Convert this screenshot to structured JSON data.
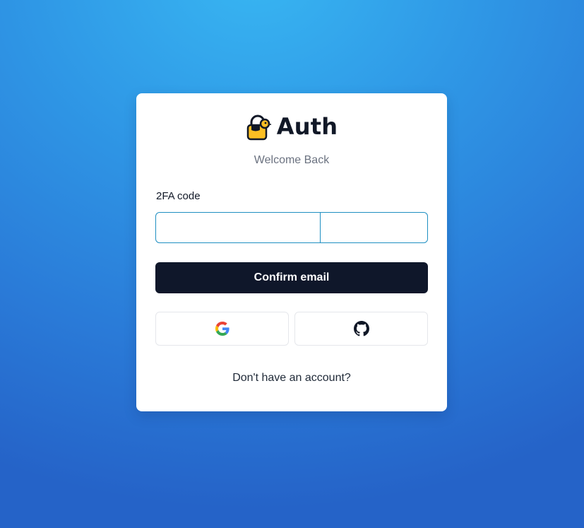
{
  "brand": {
    "name": "Auth",
    "logo_icon": "padlock-bird-icon"
  },
  "subtitle": "Welcome Back",
  "otp": {
    "label": "2FA code",
    "digits": [
      "",
      "",
      "",
      "",
      "",
      ""
    ]
  },
  "confirm_button_label": "Confirm email",
  "social": {
    "google_icon": "google-icon",
    "github_icon": "github-icon"
  },
  "signup_link_text": "Don't have an account?",
  "colors": {
    "background_top": "#38b6f2",
    "background_bottom": "#2563c8",
    "primary_button": "#0f172a",
    "otp_border": "#1f8fc2",
    "logo_yellow": "#fbbf24"
  }
}
